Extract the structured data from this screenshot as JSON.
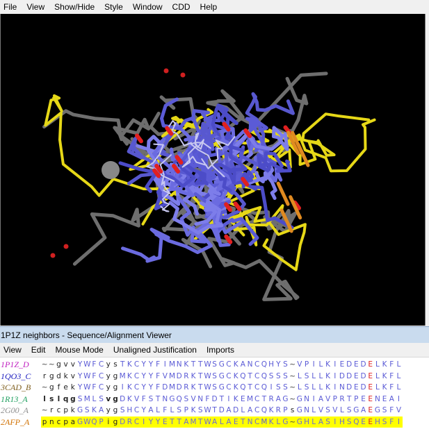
{
  "menu": [
    "File",
    "View",
    "Show/Hide",
    "Style",
    "Window",
    "CDD",
    "Help"
  ],
  "alignment_window": {
    "title": "1P1Z neighbors - Sequence/Alignment Viewer",
    "menu": [
      "View",
      "Edit",
      "Mouse Mode",
      "Unaligned Justification",
      "Imports"
    ]
  },
  "colors": {
    "background": "#000000",
    "aligned_residue": "#5b5bd6",
    "highlight_backbone": "#e6d817",
    "conserved_residue": "#e02020",
    "unaligned_residue": "#222222",
    "selection_highlight": "#ffff00"
  },
  "sequences": [
    {
      "name": "1P1Z_D",
      "name_color": "#c020c0",
      "residues": "~~gvvYWFCysTKCYYFIMNKTTWSGCKANCQHYS~VPILKIEDEDELKFL",
      "highlight": false
    },
    {
      "name": "1QO3_C",
      "name_color": "#2020c0",
      "residues": "rgdkvYWFCygMKCYYFVMDRKTWSGCKQTCQSSS~LSLLKIDDEDELKFL",
      "highlight": false
    },
    {
      "name": "3CAD_B",
      "name_color": "#806020",
      "residues": "~gfekYWFCygIKCYYFDMDRKTWSGCKQTCQISS~LSLLKINDEDELKFL",
      "highlight": false
    },
    {
      "name": "1R13_A",
      "name_color": "#20a060",
      "residues": "lslqgSMLSvgDKVFSTNGQSVNFDTIKEMCTRAG~GNIAVPRTPEENEAI",
      "highlight": false
    },
    {
      "name": "2G00_A",
      "name_color": "#909090",
      "residues": "~rcpkGSKAygSHCYALFLSPKSWTDADLACQKRPsGNLVSVLSGAEGSFV",
      "highlight": false
    },
    {
      "name": "2AFP_A",
      "name_color": "#d07000",
      "residues": "pncpaGWQPigDRCIYYETTAMTWALAETNCMKLG~GHLASIHSQEEHSFI",
      "highlight": true
    }
  ]
}
